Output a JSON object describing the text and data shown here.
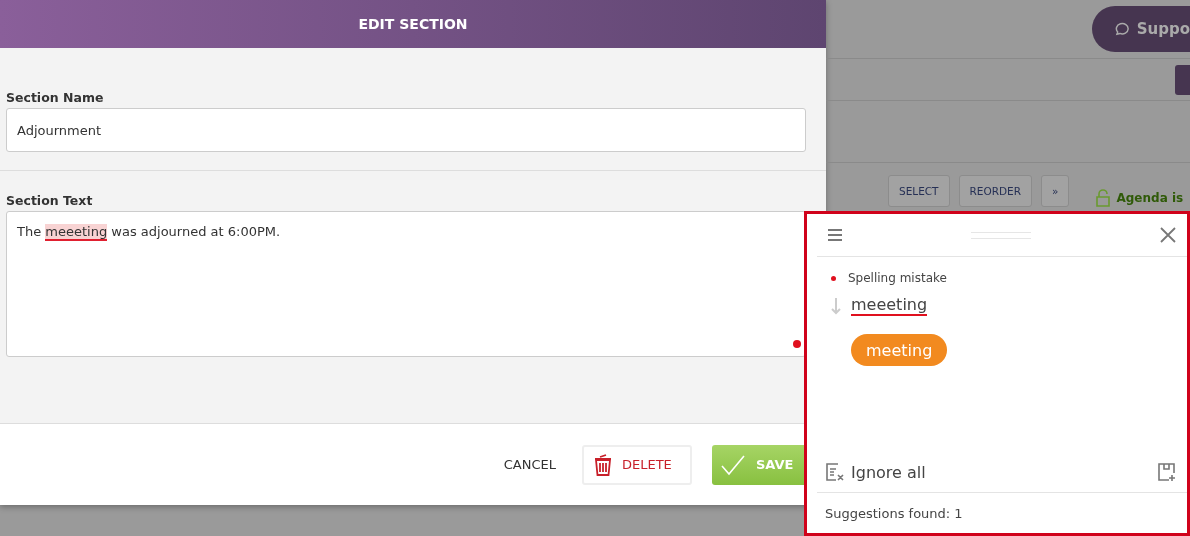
{
  "modal": {
    "title": "EDIT SECTION",
    "name_field": {
      "label": "Section Name",
      "value": "Adjournment"
    },
    "text_field": {
      "label": "Section Text",
      "segments": [
        {
          "text": "The ",
          "flagged": false
        },
        {
          "text": "meeeting",
          "flagged": true
        },
        {
          "text": " was adjourned at 6:00PM.",
          "flagged": false
        }
      ]
    },
    "buttons": [
      {
        "kind": "plain",
        "label": "CANCEL"
      },
      {
        "kind": "delete",
        "label": "DELETE"
      },
      {
        "kind": "save",
        "label": "SAVE"
      }
    ]
  },
  "background": {
    "support_button": "Suppo",
    "toolbar_buttons": [
      {
        "kind": "text",
        "label": "SELECT"
      },
      {
        "kind": "text",
        "label": "REORDER"
      },
      {
        "kind": "text",
        "label": "»"
      }
    ],
    "agenda_status": "Agenda is"
  },
  "checker": {
    "issue_type": "Spelling mistake",
    "word": "meeeting",
    "suggestions": [
      "meeting"
    ],
    "ignore_label": "Ignore all",
    "status": "Suggestions found: 1"
  }
}
